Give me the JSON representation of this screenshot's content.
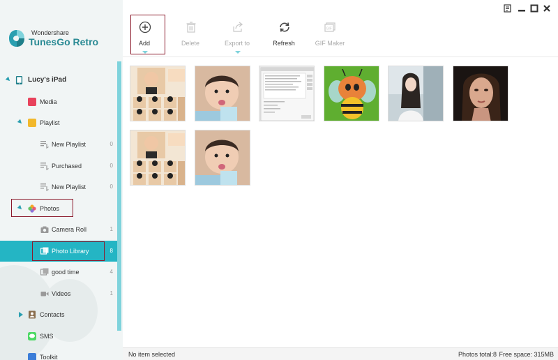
{
  "brand": {
    "company": "Wondershare",
    "product": "TunesGo Retro"
  },
  "window_controls": [
    "menu-icon",
    "minimize-icon",
    "maximize-icon",
    "close-icon"
  ],
  "sidebar": {
    "device": "Lucy's iPad",
    "items": [
      {
        "label": "Media"
      },
      {
        "label": "Playlist"
      },
      {
        "label": "New Playlist",
        "count": "0"
      },
      {
        "label": "Purchased",
        "count": "0"
      },
      {
        "label": "New Playlist",
        "count": "0"
      },
      {
        "label": "Photos"
      },
      {
        "label": "Camera Roll",
        "count": "1"
      },
      {
        "label": "Photo Library",
        "count": "8"
      },
      {
        "label": "good time",
        "count": "4"
      },
      {
        "label": "Videos",
        "count": "1"
      },
      {
        "label": "Contacts"
      },
      {
        "label": "SMS"
      },
      {
        "label": "Toolkit"
      }
    ]
  },
  "toolbar": {
    "add": "Add",
    "delete": "Delete",
    "export": "Export to",
    "refresh": "Refresh",
    "gif": "GIF Maker"
  },
  "photos": [
    {
      "name": "baby-collage"
    },
    {
      "name": "baby-ice-cream"
    },
    {
      "name": "screenshot-dialog"
    },
    {
      "name": "cartoon-bee"
    },
    {
      "name": "girl-outdoor"
    },
    {
      "name": "woman-portrait"
    },
    {
      "name": "baby-collage"
    },
    {
      "name": "baby-ice-cream"
    }
  ],
  "status": {
    "selection": "No item selected",
    "total": "Photos total:8",
    "free": "Free space: 315MB"
  },
  "colors": {
    "accent": "#24b5c4",
    "brand": "#2a8a94",
    "highlight_box": "#8b1a2c"
  }
}
